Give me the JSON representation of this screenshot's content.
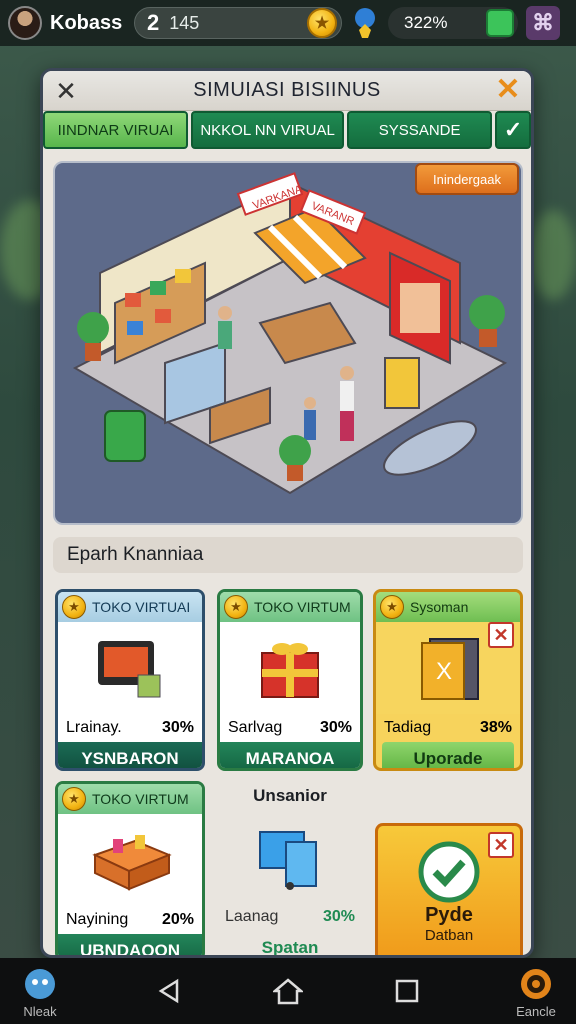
{
  "hud": {
    "player_name": "Kobass",
    "level": "2",
    "coins": "145",
    "percent": "322%"
  },
  "modal": {
    "title": "SIMUIASI BISIINUS",
    "tabs": [
      "IINDNAR VIRUAI",
      "NKKOL NN VIRUAL",
      "SYSSANDE"
    ],
    "badge": "Inindergaak",
    "scene_signs": [
      "VARKANA",
      "VARANR"
    ],
    "section_title": "Eparh Knanniaa"
  },
  "cards": [
    {
      "title": "TOKO VIRTUAI",
      "stat_label": "Lrainay.",
      "stat_value": "30%",
      "button": "YSNBARON"
    },
    {
      "title": "TOKO VIRTUM",
      "stat_label": "Sarlvag",
      "stat_value": "30%",
      "button": "MARANOA"
    },
    {
      "title": "Sysoman",
      "stat_label": "Tadiag",
      "stat_value": "38%",
      "button": "Uporade"
    },
    {
      "title": "TOKO VIRTUM",
      "stat_label": "Nayining",
      "stat_value": "20%",
      "button": "UBNDAQON"
    },
    {
      "title": "Unsanior",
      "stat_label": "Laanag",
      "stat_value": "30%",
      "button": "Spatan"
    },
    {
      "title": "Pyde",
      "subtitle": "Datban"
    }
  ],
  "nav": {
    "left_label": "Nleak",
    "right_label": "Eancle"
  },
  "colors": {
    "accent_green": "#1f8a52",
    "accent_orange": "#e88d1a",
    "gold": "#f7d35c"
  }
}
